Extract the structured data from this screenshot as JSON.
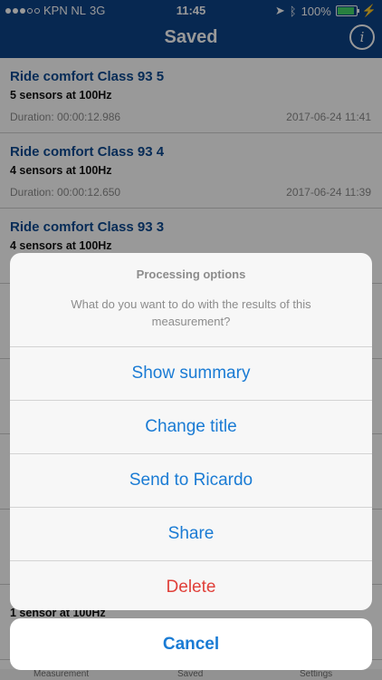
{
  "status": {
    "carrier": "KPN NL",
    "network": "3G",
    "time": "11:45",
    "battery": "100%"
  },
  "nav": {
    "title": "Saved",
    "info_icon": "info-icon"
  },
  "rows": [
    {
      "title": "Ride comfort Class 93 5",
      "sensors": "5 sensors at 100Hz",
      "duration": "Duration: 00:00:12.986",
      "date": "2017-06-24 11:41"
    },
    {
      "title": "Ride comfort Class 93 4",
      "sensors": "4 sensors at 100Hz",
      "duration": "Duration: 00:00:12.650",
      "date": "2017-06-24 11:39"
    },
    {
      "title": "Ride comfort Class 93 3",
      "sensors": "4 sensors at 100Hz",
      "duration": "",
      "date": ""
    }
  ],
  "last_row_sensors": "1 sensor at 100Hz",
  "tabs": {
    "measurement": "Measurement",
    "saved": "Saved",
    "settings": "Settings"
  },
  "sheet": {
    "title": "Processing options",
    "message": "What do you want to do with the results of this measurement?",
    "actions": {
      "show_summary": "Show summary",
      "change_title": "Change title",
      "send": "Send to Ricardo",
      "share": "Share",
      "delete": "Delete"
    },
    "cancel": "Cancel"
  },
  "colors": {
    "nav": "#0d4387",
    "accent": "#1a7bd4",
    "destructive": "#e0403a"
  }
}
